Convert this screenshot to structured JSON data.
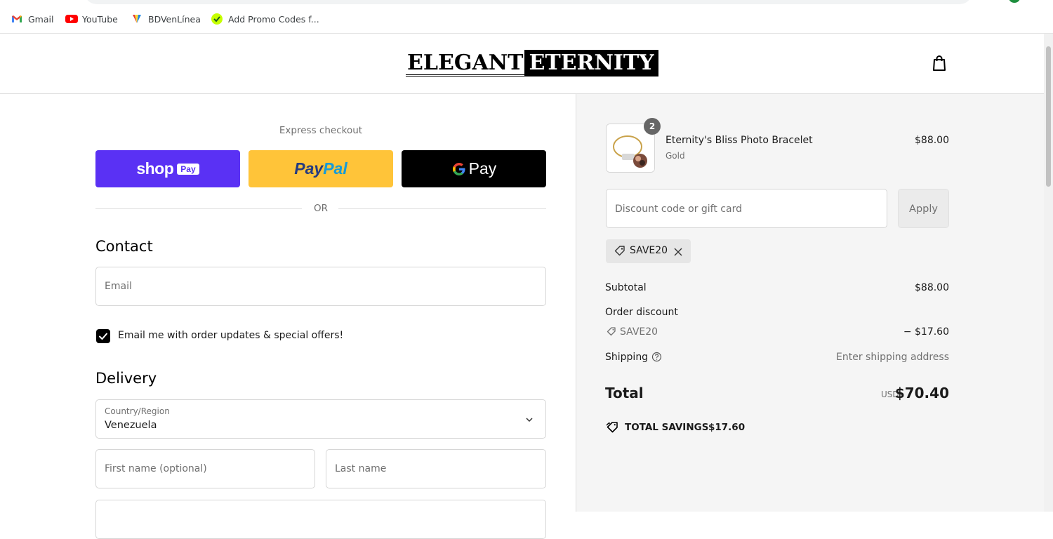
{
  "bookmarks": [
    {
      "label": "Gmail",
      "icon": "gmail-icon"
    },
    {
      "label": "YouTube",
      "icon": "youtube-icon"
    },
    {
      "label": "BDVenLínea",
      "icon": "bdv-icon"
    },
    {
      "label": "Add Promo Codes f...",
      "icon": "promo-icon"
    }
  ],
  "header": {
    "logo_part1": "ELEGANT",
    "logo_part2": "ETERNITY",
    "cart_icon": "shopping-bag-icon"
  },
  "express": {
    "title": "Express checkout",
    "shop_label": "shop",
    "shop_badge": "Pay",
    "paypal_pay": "Pay",
    "paypal_pal": "Pal",
    "gpay_label": "Pay",
    "or_label": "OR"
  },
  "contact": {
    "heading": "Contact",
    "email_placeholder": "Email",
    "newsletter_label": "Email me with order updates & special offers!",
    "newsletter_checked": true
  },
  "delivery": {
    "heading": "Delivery",
    "country_label": "Country/Region",
    "country_value": "Venezuela",
    "first_name_placeholder": "First name (optional)",
    "last_name_placeholder": "Last name"
  },
  "summary": {
    "item": {
      "name": "Eternity's Bliss Photo Bracelet",
      "variant": "Gold",
      "price": "$88.00",
      "quantity": "2"
    },
    "discount_placeholder": "Discount code or gift card",
    "apply_label": "Apply",
    "applied_code": "SAVE20",
    "subtotal_label": "Subtotal",
    "subtotal_value": "$88.00",
    "order_discount_label": "Order discount",
    "order_discount_code": "SAVE20",
    "order_discount_value": "− $17.60",
    "shipping_label": "Shipping",
    "shipping_value": "Enter shipping address",
    "total_label": "Total",
    "total_currency": "USD",
    "total_value": "$70.40",
    "savings_label": "TOTAL SAVINGS",
    "savings_value": "$17.60"
  },
  "colors": {
    "shop_pay": "#5a31f4",
    "paypal": "#ffc439",
    "gpay": "#000000",
    "summary_bg": "#f5f5f5"
  }
}
